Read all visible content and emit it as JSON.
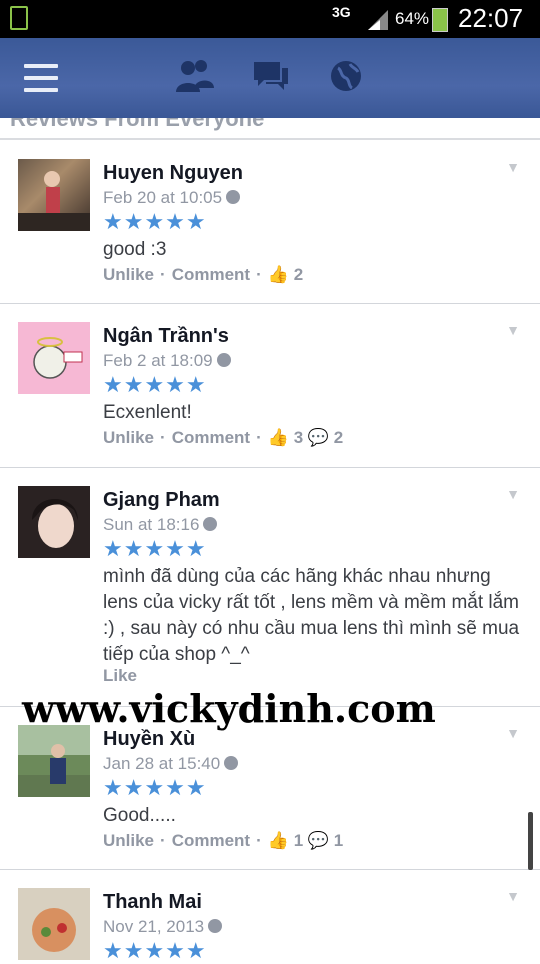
{
  "status_bar": {
    "network": "3G",
    "battery": "64%",
    "time": "22:07"
  },
  "navbar": {
    "icons": [
      "menu-icon",
      "friends-icon",
      "messages-icon",
      "globe-icon"
    ]
  },
  "section": {
    "title": "Reviews From Everyone"
  },
  "reviews": [
    {
      "name": "Huyen Nguyen",
      "date": "Feb 20 at 10:05",
      "stars": "★★★★★",
      "text": "good :3",
      "unlike": "Unlike",
      "comment": "Comment",
      "likes": "2",
      "comments": ""
    },
    {
      "name": "Ngân Trầnn's",
      "date": "Feb 2 at 18:09",
      "stars": "★★★★★",
      "text": "Ecxenlent!",
      "unlike": "Unlike",
      "comment": "Comment",
      "likes": "3",
      "comments": "2"
    },
    {
      "name": "Gjang Pham",
      "date": "Sun at 18:16",
      "stars": "★★★★★",
      "text": "mình đã dùng của các hãng khác nhau nhưng lens của vicky rất tốt , lens mềm và mềm mắt lắm :) , sau này có nhu cầu mua lens thì mình sẽ mua tiếp của shop ^_^",
      "like": "Like"
    },
    {
      "name": "Huyền Xù",
      "date": "Jan 28 at 15:40",
      "stars": "★★★★★",
      "text": "Good.....",
      "unlike": "Unlike",
      "comment": "Comment",
      "likes": "1",
      "comments": "1"
    },
    {
      "name": "Thanh Mai",
      "date": "Nov 21, 2013",
      "stars": "★★★★★"
    }
  ],
  "watermark": "www.vickydinh.com"
}
